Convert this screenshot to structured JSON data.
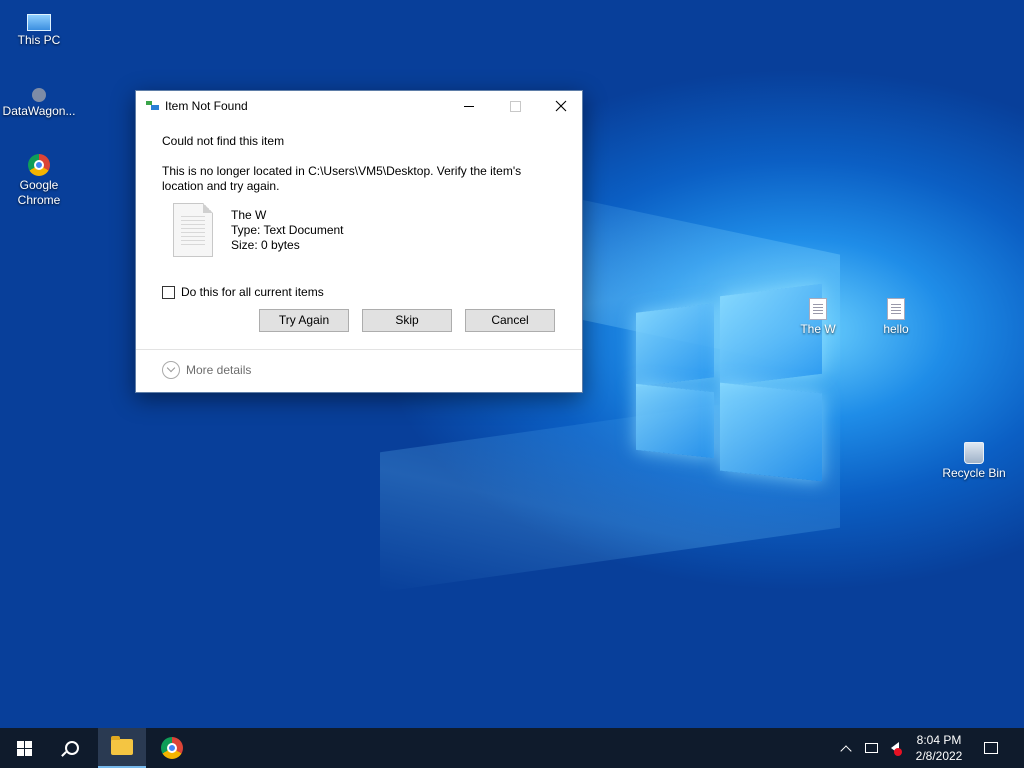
{
  "desktop": {
    "icons": [
      {
        "label": "This PC",
        "icon": "this-pc-icon"
      },
      {
        "label": "DataWagon...",
        "icon": "datawagon-icon"
      },
      {
        "label": "Google Chrome",
        "icon": "chrome-icon"
      },
      {
        "label": "The W",
        "icon": "text-document-icon"
      },
      {
        "label": "hello",
        "icon": "text-document-icon"
      },
      {
        "label": "Recycle Bin",
        "icon": "recycle-bin-icon"
      }
    ]
  },
  "dialog": {
    "title": "Item Not Found",
    "heading": "Could not find this item",
    "message": "This is no longer located in C:\\Users\\VM5\\Desktop. Verify the item's location and try again.",
    "file": {
      "name": "The W",
      "type": "Type: Text Document",
      "size": "Size: 0 bytes"
    },
    "checkbox_label": "Do this for all current items",
    "checkbox_checked": false,
    "buttons": {
      "try_again": "Try Again",
      "skip": "Skip",
      "cancel": "Cancel"
    },
    "more_details": "More details"
  },
  "taskbar": {
    "pinned": [
      "windows-start-icon",
      "search-icon",
      "file-explorer-icon",
      "chrome-icon"
    ],
    "clock": {
      "time": "8:04 PM",
      "date": "2/8/2022"
    }
  },
  "colors": {
    "desktop_accent": "#0a66d4",
    "taskbar": "#0f1b2c",
    "button_face": "#e1e1e1"
  }
}
